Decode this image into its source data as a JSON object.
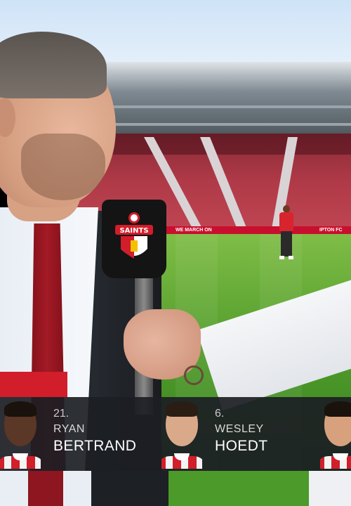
{
  "stadium": {
    "banner_left": "WE MARCH ON",
    "banner_right": "IPTON FC"
  },
  "microphone": {
    "badge_text": "SAINTS",
    "badge_colors": {
      "red": "#d21d2a",
      "white": "#ffffff",
      "black": "#141414"
    }
  },
  "lineup": {
    "players": [
      {
        "number": "21.",
        "first_name": "RYAN",
        "last_name": "BERTRAND"
      },
      {
        "number": "6.",
        "first_name": "WESLEY",
        "last_name": "HOEDT"
      }
    ],
    "kit_colors": {
      "red": "#d11f2b",
      "white": "#f3f3f3"
    },
    "bar_color": "#1c1e24",
    "accent": "#d21d2a"
  }
}
